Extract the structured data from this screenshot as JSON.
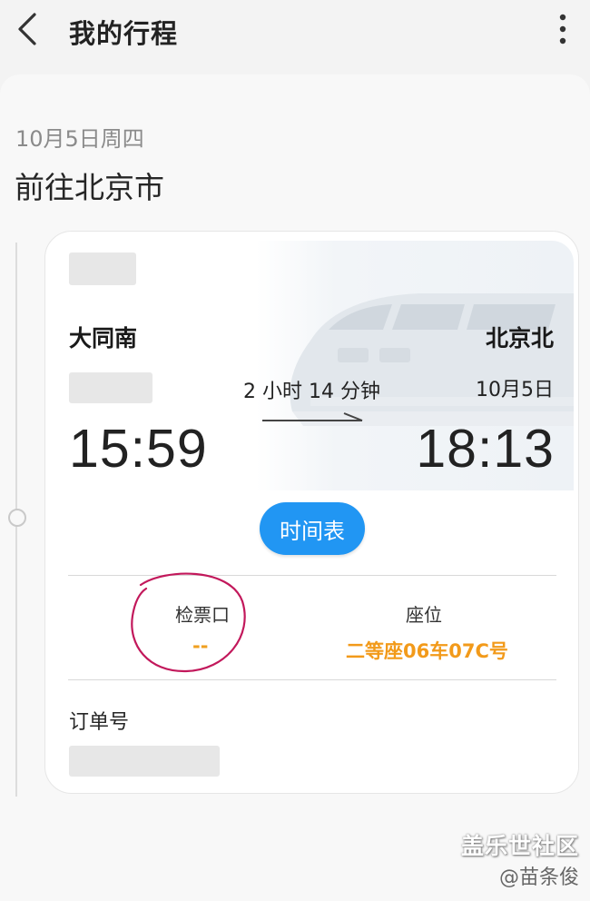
{
  "header": {
    "title": "我的行程",
    "back_icon": "chevron-left-icon",
    "menu_icon": "more-vertical-icon"
  },
  "trip": {
    "date": "10月5日周四",
    "destination": "前往北京市",
    "card": {
      "from_station": "大同南",
      "to_station": "北京北",
      "duration": "2 小时 14 分钟",
      "arrive_date": "10月5日",
      "depart_time": "15:59",
      "arrive_time": "18:13",
      "timetable_button": "时间表",
      "gate_label": "检票口",
      "gate_value": "--",
      "seat_label": "座位",
      "seat_value": "二等座06车07C号",
      "order_label": "订单号"
    }
  },
  "watermark": {
    "brand": "盖乐世社区",
    "author": "@苗条俊"
  },
  "colors": {
    "accent_blue": "#2196f3",
    "seat_orange": "#f29a1a",
    "annotation_pink": "#c2185b"
  }
}
